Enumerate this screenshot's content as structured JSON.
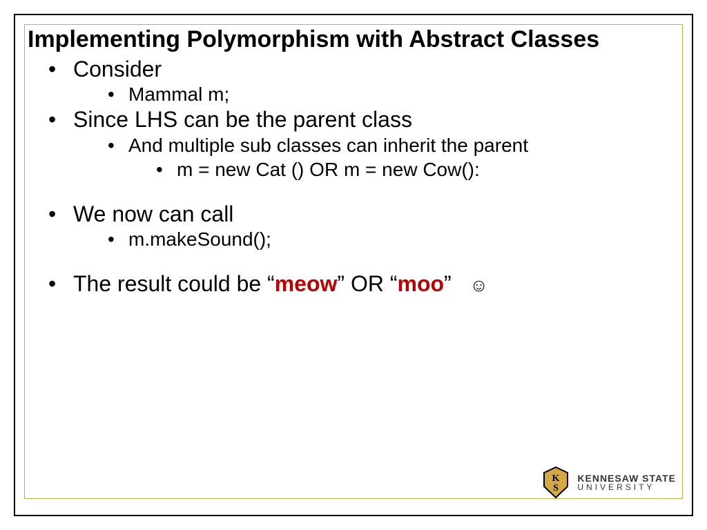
{
  "title": "Implementing Polymorphism with Abstract Classes",
  "b1": "Consider",
  "b1_1": "Mammal m;",
  "b2": "Since LHS can be the parent class",
  "b2_1": "And multiple sub classes can inherit the parent",
  "b2_1_1": "m = new Cat () OR m = new Cow():",
  "b3": "We now can call",
  "b3_1": "m.makeSound();",
  "b4_pre": "The result could be “",
  "b4_meow": "meow",
  "b4_mid": "” OR “",
  "b4_moo": "moo",
  "b4_post": "”   ",
  "b4_smiley": "☺",
  "logo": {
    "line1": "KENNESAW STATE",
    "line2": "UNIVERSITY"
  }
}
